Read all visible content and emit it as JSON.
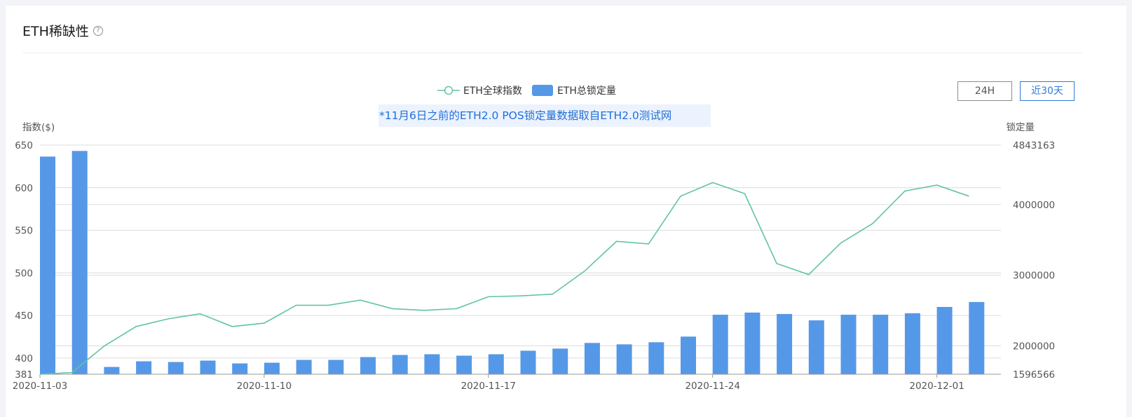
{
  "title": "ETH稀缺性",
  "help_icon": "question-circle-icon",
  "buttons": {
    "h24": "24H",
    "d30": "近30天"
  },
  "notice": "*11月6日之前的ETH2.0 POS锁定量数据取自ETH2.0测试网",
  "colors": {
    "line": "#62c4a2",
    "bar": "#5598e8",
    "accent": "#2f7bd9"
  },
  "chart_data": {
    "type": "bar",
    "legend": [
      "ETH全球指数",
      "ETH总锁定量"
    ],
    "y_left_label": "指数($)",
    "y_right_label": "锁定量",
    "y_left_ticks": [
      "650",
      "600",
      "550",
      "500",
      "450",
      "400",
      "381"
    ],
    "y_left_range": [
      381,
      650
    ],
    "y_right_ticks": [
      "4843163",
      "4000000",
      "3000000",
      "2000000",
      "1596566"
    ],
    "y_right_range": [
      1596566,
      4843163
    ],
    "x_tick_labels": [
      "2020-11-03",
      "2020-11-10",
      "2020-11-17",
      "2020-11-24",
      "2020-12-01"
    ],
    "x": [
      "2020-11-03",
      "2020-11-04",
      "2020-11-05",
      "2020-11-06",
      "2020-11-07",
      "2020-11-08",
      "2020-11-09",
      "2020-11-10",
      "2020-11-11",
      "2020-11-12",
      "2020-11-13",
      "2020-11-14",
      "2020-11-15",
      "2020-11-16",
      "2020-11-17",
      "2020-11-18",
      "2020-11-19",
      "2020-11-20",
      "2020-11-21",
      "2020-11-22",
      "2020-11-23",
      "2020-11-24",
      "2020-11-25",
      "2020-11-26",
      "2020-11-27",
      "2020-11-28",
      "2020-11-29",
      "2020-11-30",
      "2020-12-01",
      "2020-12-02",
      "2020-12-03"
    ],
    "series": [
      {
        "name": "ETH全球指数",
        "type": "line",
        "values": [
          381,
          383,
          414,
          437,
          446,
          452,
          437,
          441,
          462,
          462,
          468,
          458,
          456,
          458,
          472,
          473,
          475,
          502,
          537,
          534,
          590,
          606,
          593,
          511,
          498,
          535,
          558,
          596,
          603,
          590
        ]
      },
      {
        "name": "ETH总锁定量",
        "type": "bar",
        "values": [
          4680000,
          4760000,
          1700000,
          1780000,
          1770000,
          1790000,
          1750000,
          1760000,
          1800000,
          1800000,
          1840000,
          1870000,
          1880000,
          1860000,
          1880000,
          1930000,
          1960000,
          2040000,
          2020000,
          2050000,
          2130000,
          2440000,
          2470000,
          2450000,
          2360000,
          2440000,
          2440000,
          2460000,
          2550000,
          2620000
        ]
      }
    ]
  }
}
